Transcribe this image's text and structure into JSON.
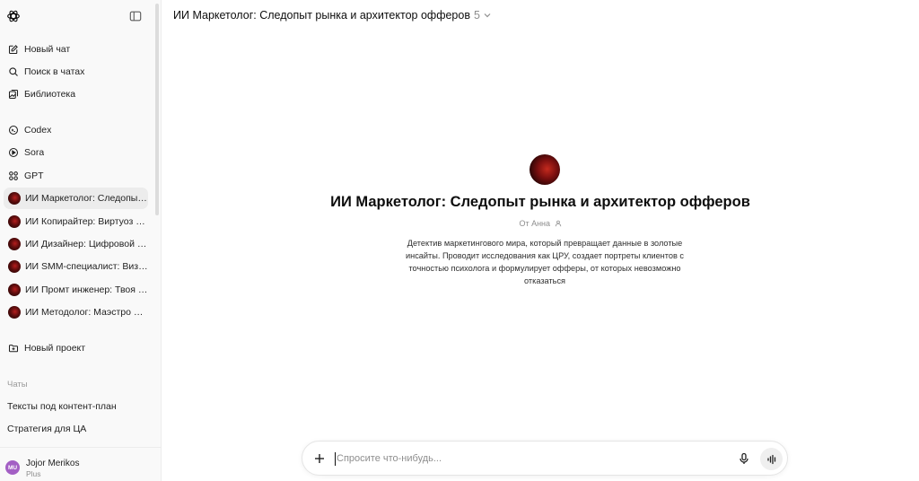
{
  "sidebar": {
    "nav": [
      {
        "label": "Новый чат",
        "icon": "edit-icon"
      },
      {
        "label": "Поиск в чатах",
        "icon": "search-icon"
      },
      {
        "label": "Библиотека",
        "icon": "library-icon"
      }
    ],
    "apps": [
      {
        "label": "Codex",
        "icon": "codex-icon"
      },
      {
        "label": "Sora",
        "icon": "sora-icon"
      },
      {
        "label": "GPT",
        "icon": "gpt-grid-icon"
      }
    ],
    "gpts": [
      {
        "label": "ИИ Маркетолог: Следопыт рынка и архитектор офферов"
      },
      {
        "label": "ИИ Копирайтер: Виртуоз слова"
      },
      {
        "label": "ИИ Дизайнер: Цифровой художник"
      },
      {
        "label": "ИИ SMM-специалист: Визионер"
      },
      {
        "label": "ИИ Промт инженер: Твоя правая рука"
      },
      {
        "label": "ИИ Методолог: Маэстро обучения"
      }
    ],
    "new_project": "Новый проект",
    "chats_title": "Чаты",
    "chats": [
      "Тексты под контент-план",
      "Стратегия для ЦА"
    ],
    "user": {
      "initials": "MU",
      "name": "Jojor Merikos",
      "plan": "Plus"
    }
  },
  "header": {
    "title": "ИИ Маркетолог: Следопыт рынка и архитектор офферов",
    "version": "5"
  },
  "gpt": {
    "title": "ИИ Маркетолог: Следопыт рынка и архитектор офферов",
    "author": "От Анна",
    "description": "Детектив маркетингового мира, который превращает данные в золотые инсайты. Проводит исследования как ЦРУ, создает портреты клиентов с точностью психолога и формулирует офферы, от которых невозможно отказаться"
  },
  "composer": {
    "placeholder": "Спросите что-нибудь..."
  },
  "colors": {
    "sidebar_bg": "#f9f9f9",
    "active_item": "#ececec",
    "user_avatar": "#a35fc4"
  }
}
